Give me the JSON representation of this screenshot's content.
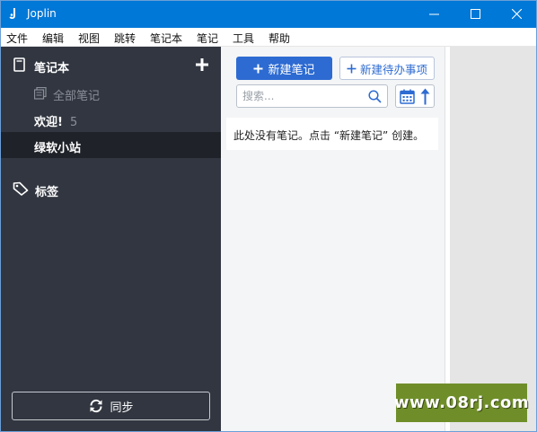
{
  "window": {
    "title": "Joplin",
    "accent": "#0078d7",
    "controls": [
      "minimize-icon",
      "maximize-icon",
      "close-icon"
    ]
  },
  "menu": {
    "items": [
      "文件",
      "编辑",
      "视图",
      "跳转",
      "笔记本",
      "笔记",
      "工具",
      "帮助"
    ]
  },
  "sidebar": {
    "header": "笔记本",
    "all_notes": "全部笔记",
    "notebooks": [
      {
        "name": "欢迎!",
        "count": "5"
      },
      {
        "name": "绿软小站",
        "count": ""
      }
    ],
    "tags": "标签",
    "sync": "同步",
    "bg_color": "#313640"
  },
  "notelist": {
    "new_note": "新建笔记",
    "new_todo": "新建待办事项",
    "search_placeholder": "搜索...",
    "empty_message": "此处没有笔记。点击 “新建笔记” 创建。",
    "primary_color": "#2d6bd2"
  },
  "watermark": {
    "text": "www.08rj.com"
  }
}
